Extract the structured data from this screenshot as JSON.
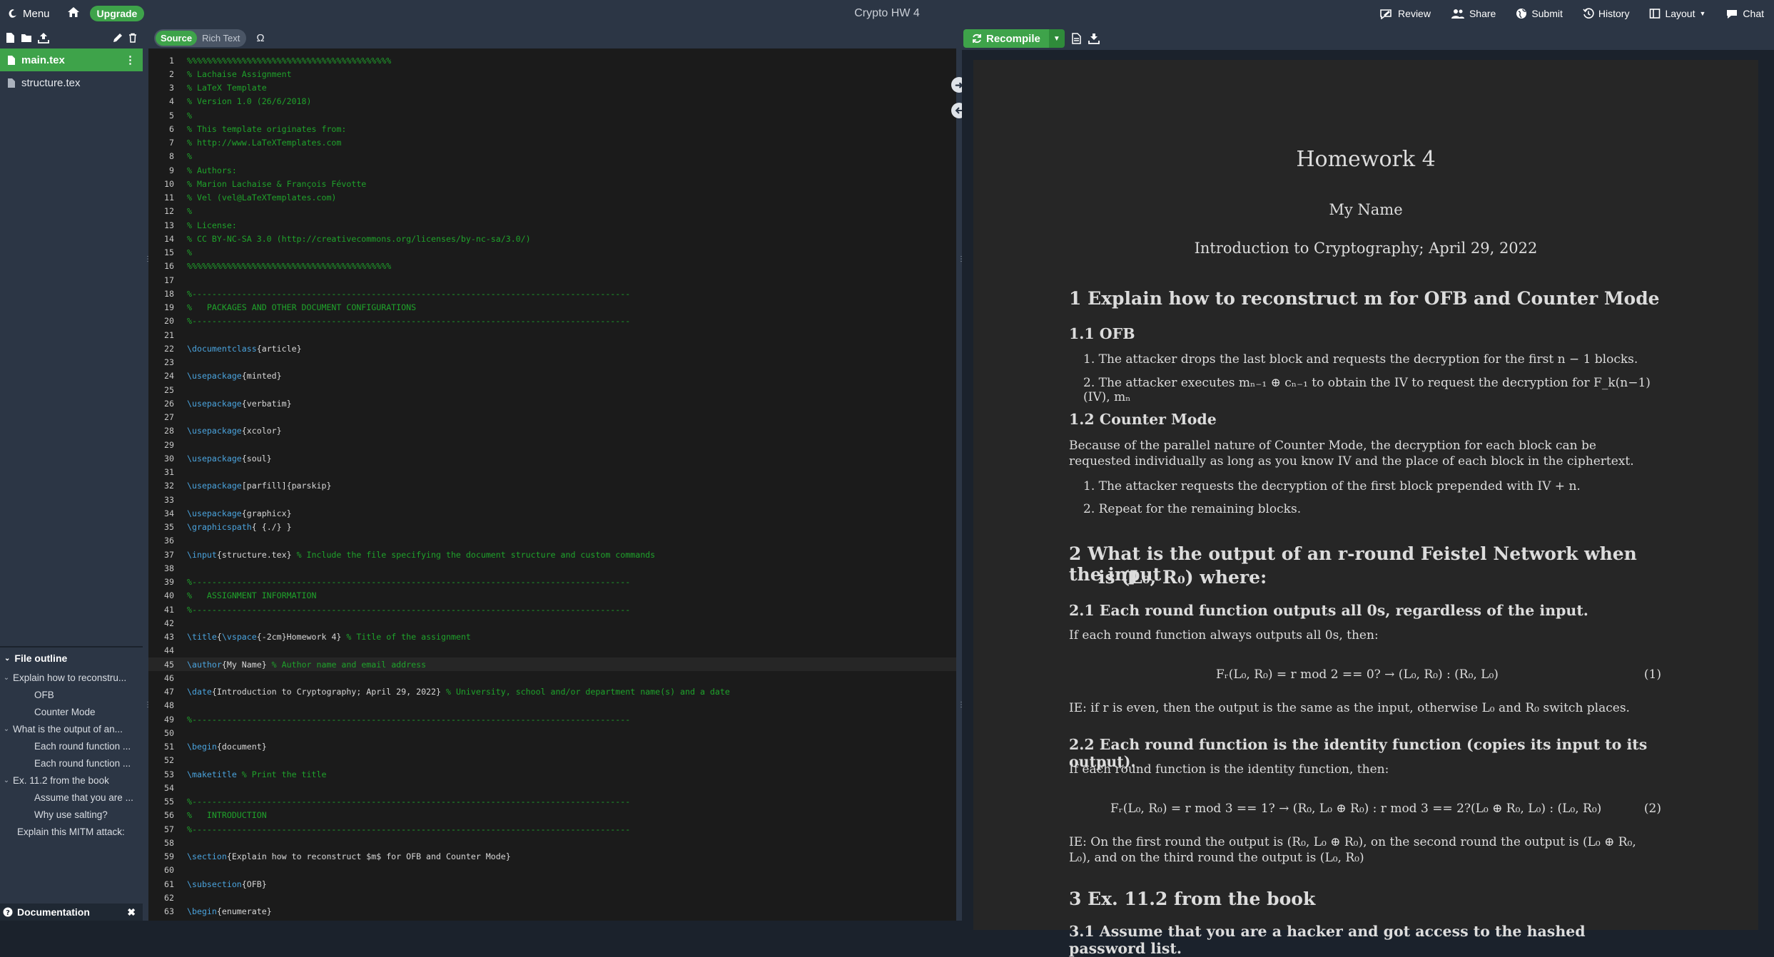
{
  "topbar": {
    "menu_label": "Menu",
    "upgrade_label": "Upgrade",
    "project_title": "Crypto HW 4",
    "review_label": "Review",
    "share_label": "Share",
    "submit_label": "Submit",
    "history_label": "History",
    "layout_label": "Layout",
    "chat_label": "Chat"
  },
  "files": {
    "items": [
      "main.tex",
      "structure.tex"
    ]
  },
  "outline": {
    "title": "File outline",
    "rows": [
      "Explain how to reconstru...",
      "OFB",
      "Counter Mode",
      "What is the output of an...",
      "Each round function ...",
      "Each round function ...",
      "Ex. 11.2 from the book",
      "Assume that you are ...",
      "Why use salting?",
      "Explain this MITM attack:"
    ]
  },
  "documentation_label": "Documentation",
  "editor": {
    "source_label": "Source",
    "rich_text_label": "Rich Text",
    "omega_label": "Ω",
    "line_numbers": [
      "1",
      "2",
      "3",
      "4",
      "5",
      "6",
      "7",
      "8",
      "9",
      "10",
      "11",
      "12",
      "13",
      "14",
      "15",
      "16",
      "17",
      "18",
      "19",
      "20",
      "21",
      "22",
      "23",
      "24",
      "25",
      "26",
      "27",
      "28",
      "29",
      "30",
      "31",
      "32",
      "33",
      "34",
      "35",
      "36",
      "37",
      "38",
      "39",
      "40",
      "41",
      "42",
      "43",
      "44",
      "45",
      "46",
      "47",
      "48",
      "49",
      "50",
      "51",
      "52",
      "53",
      "54",
      "55",
      "56",
      "57",
      "58",
      "59",
      "60",
      "61",
      "62",
      "63"
    ],
    "lines": [
      "%%%%%%%%%%%%%%%%%%%%%%%%%%%%%%%%%%%%%%%%%",
      "% Lachaise Assignment",
      "% LaTeX Template",
      "% Version 1.0 (26/6/2018)",
      "%",
      "% This template originates from:",
      "% http://www.LaTeXTemplates.com",
      "%",
      "% Authors:",
      "% Marion Lachaise & François Févotte",
      "% Vel (vel@LaTeXTemplates.com)",
      "%",
      "% License:",
      "% CC BY-NC-SA 3.0 (http://creativecommons.org/licenses/by-nc-sa/3.0/)",
      "%",
      "%%%%%%%%%%%%%%%%%%%%%%%%%%%%%%%%%%%%%%%%%",
      "",
      "%----------------------------------------------------------------------------------------",
      "%   PACKAGES AND OTHER DOCUMENT CONFIGURATIONS",
      "%----------------------------------------------------------------------------------------",
      "",
      "\\documentclass{article}",
      "",
      "\\usepackage{minted}",
      "",
      "\\usepackage{verbatim}",
      "",
      "\\usepackage{xcolor}",
      "",
      "\\usepackage{soul}",
      "",
      "\\usepackage[parfill]{parskip}",
      "",
      "\\usepackage{graphicx}",
      "\\graphicspath{ {./} }",
      "",
      "\\input{structure.tex} % Include the file specifying the document structure and custom commands",
      "",
      "%----------------------------------------------------------------------------------------",
      "%   ASSIGNMENT INFORMATION",
      "%----------------------------------------------------------------------------------------",
      "",
      "\\title{\\vspace{-2cm}Homework 4} % Title of the assignment",
      "",
      "\\author{My Name} % Author name and email address",
      "",
      "\\date{Introduction to Cryptography; April 29, 2022} % University, school and/or department name(s) and a date",
      "",
      "%----------------------------------------------------------------------------------------",
      "",
      "\\begin{document}",
      "",
      "\\maketitle % Print the title",
      "",
      "%----------------------------------------------------------------------------------------",
      "%   INTRODUCTION",
      "%----------------------------------------------------------------------------------------",
      "",
      "\\section{Explain how to reconstruct $m$ for OFB and Counter Mode}",
      "",
      "\\subsection{OFB}",
      "",
      "\\begin{enumerate}"
    ]
  },
  "preview": {
    "recompile_label": "Recompile",
    "title": "Homework 4",
    "author": "My Name",
    "date": "Introduction to Cryptography; April 29, 2022",
    "s1": "1   Explain how to reconstruct m for OFB and Counter Mode",
    "s1_1": "1.1   OFB",
    "s1_1_i1": "1.  The attacker drops the last block and requests the decryption for the first n − 1 blocks.",
    "s1_1_i2": "2.  The attacker executes mₙ₋₁ ⊕ cₙ₋₁ to obtain the IV to request the decryption for F_k(n−1)(IV), mₙ",
    "s1_2": "1.2   Counter Mode",
    "s1_2_p": "Because of the parallel nature of Counter Mode, the decryption for each block can be requested individually as long as you know IV and the place of each block in the ciphertext.",
    "s1_2_i1": "1.  The attacker requests the decryption of the first block prepended with IV + n.",
    "s1_2_i2": "2.  Repeat for the remaining blocks.",
    "s2_l1": "2   What is the output of an r-round Feistel Network when the input",
    "s2_l2": "is (L₀, R₀) where:",
    "s2_1": "2.1   Each round function outputs all 0s, regardless of the input.",
    "s2_1_p": "If each round function always outputs all 0s, then:",
    "eq1": "Fᵣ(L₀, R₀) = r   mod 2 == 0? → (L₀, R₀) : (R₀, L₀)",
    "eq1_num": "(1)",
    "s2_1_ie": "IE: if r is even, then the output is the same as the input, otherwise L₀ and R₀ switch places.",
    "s2_2": "2.2   Each round function is the identity function (copies its input to its output).",
    "s2_2_p": "If each round function is the identity function, then:",
    "eq2": "Fᵣ(L₀, R₀) = r   mod 3 == 1? → (R₀, L₀ ⊕ R₀) : r   mod 3 == 2?(L₀ ⊕ R₀, L₀) : (L₀, R₀)",
    "eq2_num": "(2)",
    "s2_2_ie": "IE: On the first round the output is (R₀, L₀ ⊕ R₀), on the second round the output is (L₀ ⊕ R₀, L₀), and on the third round the output is (L₀, R₀)",
    "s3": "3   Ex. 11.2 from the book",
    "s3_1": "3.1   Assume that you are a hacker and got access to the hashed password list."
  }
}
